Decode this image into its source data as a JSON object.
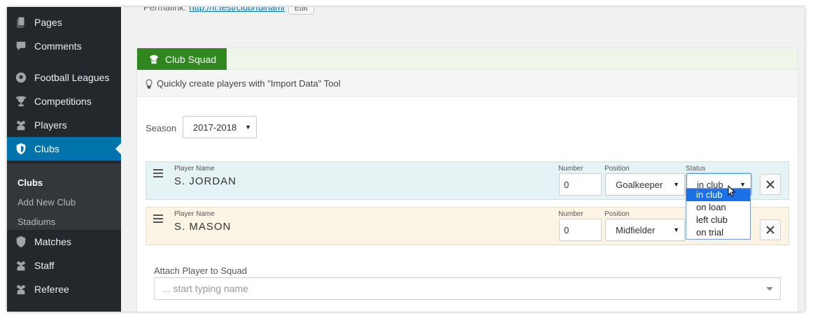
{
  "sidebar": {
    "items": [
      {
        "label": "Pages",
        "icon": "pages-icon"
      },
      {
        "label": "Comments",
        "icon": "comments-icon"
      },
      {
        "label": "Football Leagues",
        "icon": "soccer-ball-icon"
      },
      {
        "label": "Competitions",
        "icon": "trophy-icon"
      },
      {
        "label": "Players",
        "icon": "players-group-icon"
      },
      {
        "label": "Clubs",
        "icon": "shield-icon"
      },
      {
        "label": "Matches",
        "icon": "shield-half-icon"
      },
      {
        "label": "Staff",
        "icon": "staff-group-icon"
      },
      {
        "label": "Referee",
        "icon": "referee-group-icon"
      }
    ],
    "submenu": [
      "Clubs",
      "Add New Club",
      "Stadiums"
    ]
  },
  "permalink": {
    "label": "Permalink:",
    "url": "http://fl.test/club/fulham/",
    "edit_label": "Edit"
  },
  "panel": {
    "tab_label": "Club Squad",
    "hint": "Quickly create players with \"Import Data\" Tool",
    "season_label": "Season",
    "season_value": "2017-2018",
    "players": [
      {
        "name_label": "Player Name",
        "name": "S. JORDAN",
        "number_label": "Number",
        "number": "0",
        "position_label": "Position",
        "position": "Goalkeeper",
        "status_label": "Status",
        "status": "in club"
      },
      {
        "name_label": "Player Name",
        "name": "S. MASON",
        "number_label": "Number",
        "number": "0",
        "position_label": "Position",
        "position": "Midfielder"
      }
    ],
    "status_options": [
      "in club",
      "on loan",
      "left club",
      "on trial"
    ],
    "attach_label": "Attach Player to Squad",
    "attach_placeholder": "... start typing name"
  },
  "colors": {
    "sidebar_bg": "#23282d",
    "active_bg": "#0073aa",
    "tab_green": "#31871f",
    "dropdown_selected": "#1e70e6"
  }
}
